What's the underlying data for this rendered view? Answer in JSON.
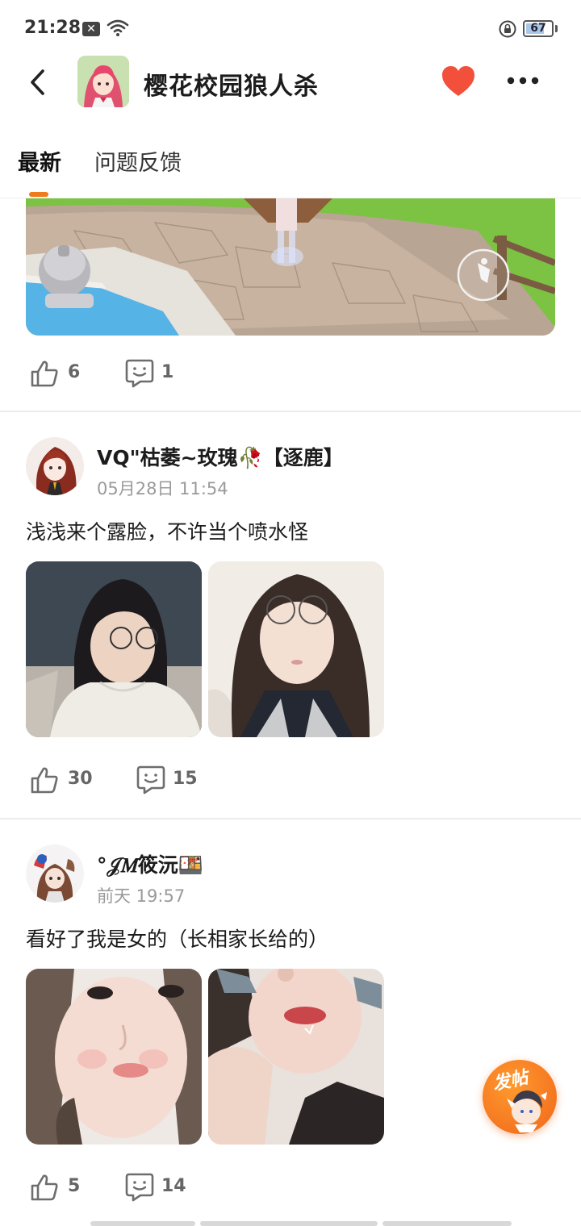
{
  "status_bar": {
    "time": "21:28",
    "notification_badge": "✕",
    "battery": "67",
    "battery_level": 0.67
  },
  "header": {
    "title": "樱花校园狼人杀",
    "back_icon": "chevron-left-icon",
    "favorite_icon": "heart-icon",
    "favorite_color": "#f2503a",
    "more_icon": "more-dots-icon"
  },
  "tabs": [
    {
      "label": "最新",
      "active": true
    },
    {
      "label": "问题反馈",
      "active": false
    }
  ],
  "accent_color": "#f07b1d",
  "posts": [
    {
      "likes": "6",
      "comments": "1"
    },
    {
      "username": "VQ\"枯萎~玫瑰🥀【逐鹿】",
      "timestamp": "05月28日 11:54",
      "text": "浅浅来个露脸，不许当个喷水怪",
      "likes": "30",
      "comments": "15"
    },
    {
      "username": "°𝒥𝑀筱沅🍱",
      "timestamp": "前天 19:57",
      "text": "看好了我是女的（长相家长给的）",
      "likes": "5",
      "comments": "14"
    }
  ],
  "fab": {
    "label": "发帖"
  }
}
